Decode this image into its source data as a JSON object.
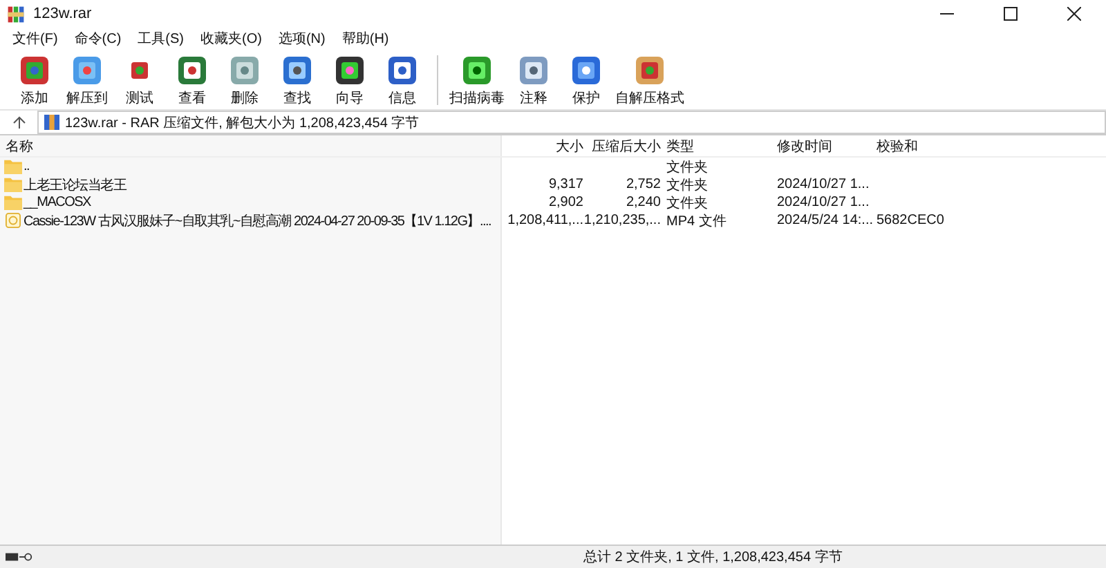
{
  "window": {
    "title": "123w.rar"
  },
  "menu": [
    "文件(F)",
    "命令(C)",
    "工具(S)",
    "收藏夹(O)",
    "选项(N)",
    "帮助(H)"
  ],
  "toolbar": {
    "groups": [
      [
        "添加",
        "解压到",
        "测试",
        "查看",
        "删除",
        "查找",
        "向导",
        "信息"
      ],
      [
        "扫描病毒",
        "注释",
        "保护",
        "自解压格式"
      ]
    ]
  },
  "address": {
    "text": "123w.rar - RAR 压缩文件, 解包大小为 1,208,423,454 字节"
  },
  "table": {
    "columns": [
      "名称",
      "大小",
      "压缩后大小",
      "类型",
      "修改时间",
      "校验和"
    ],
    "rows": [
      {
        "kind": "parent",
        "name": "..",
        "size": "",
        "packed": "",
        "type": "文件夹",
        "modified": "",
        "checksum": ""
      },
      {
        "kind": "folder",
        "name": "上老王论坛当老王",
        "size": "9,317",
        "packed": "2,752",
        "type": "文件夹",
        "modified": "2024/10/27 1...",
        "checksum": ""
      },
      {
        "kind": "folder",
        "name": "__MACOSX",
        "size": "2,902",
        "packed": "2,240",
        "type": "文件夹",
        "modified": "2024/10/27 1...",
        "checksum": ""
      },
      {
        "kind": "video",
        "name": "Cassie-123W 古风汉服妹子~自取其乳~自慰高潮  2024-04-27 20-09-35【1V 1.12G】....",
        "size": "1,208,411,...",
        "packed": "1,210,235,...",
        "type": "MP4 文件",
        "modified": "2024/5/24 14:...",
        "checksum": "5682CEC0"
      }
    ]
  },
  "status_bar": {
    "text": "总计 2 文件夹, 1 文件, 1,208,423,454 字节"
  }
}
